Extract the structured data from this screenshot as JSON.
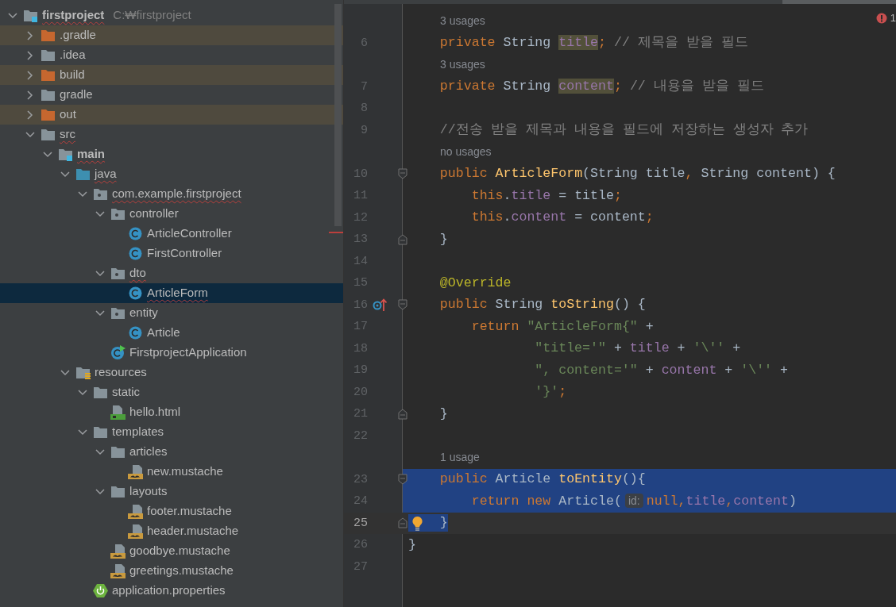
{
  "project_tree": [
    {
      "label": "firstproject",
      "path": "C:₩firstproject",
      "kind": "module",
      "expanded": true,
      "selected": false,
      "flagged": true,
      "excluded": false,
      "children": [
        {
          "label": ".gradle",
          "kind": "folder",
          "expanded": false,
          "selected": false,
          "flagged": false,
          "excluded": true
        },
        {
          "label": ".idea",
          "kind": "folder",
          "expanded": false,
          "selected": false,
          "flagged": false,
          "excluded": false
        },
        {
          "label": "build",
          "kind": "folder",
          "expanded": false,
          "selected": false,
          "flagged": false,
          "excluded": true
        },
        {
          "label": "gradle",
          "kind": "folder",
          "expanded": false,
          "selected": false,
          "flagged": false,
          "excluded": false
        },
        {
          "label": "out",
          "kind": "folder",
          "expanded": false,
          "selected": false,
          "flagged": false,
          "excluded": true
        },
        {
          "label": "src",
          "kind": "folder",
          "expanded": true,
          "selected": false,
          "flagged": true,
          "excluded": false,
          "children": [
            {
              "label": "main",
              "kind": "module",
              "expanded": true,
              "selected": false,
              "flagged": true,
              "excluded": false,
              "children": [
                {
                  "label": "java",
                  "kind": "source-folder",
                  "expanded": true,
                  "selected": false,
                  "flagged": true,
                  "excluded": false,
                  "children": [
                    {
                      "label": "com.example.firstproject",
                      "kind": "package",
                      "expanded": true,
                      "selected": false,
                      "flagged": true,
                      "excluded": false,
                      "children": [
                        {
                          "label": "controller",
                          "kind": "package",
                          "expanded": true,
                          "selected": false,
                          "flagged": false,
                          "excluded": false,
                          "children": [
                            {
                              "label": "ArticleController",
                              "kind": "class",
                              "selected": false,
                              "flagged": false,
                              "excluded": false
                            },
                            {
                              "label": "FirstController",
                              "kind": "class",
                              "selected": false,
                              "flagged": false,
                              "excluded": false
                            }
                          ]
                        },
                        {
                          "label": "dto",
                          "kind": "package",
                          "expanded": true,
                          "selected": false,
                          "flagged": true,
                          "excluded": false,
                          "children": [
                            {
                              "label": "ArticleForm",
                              "kind": "class",
                              "selected": true,
                              "flagged": true,
                              "excluded": false
                            }
                          ]
                        },
                        {
                          "label": "entity",
                          "kind": "package",
                          "expanded": true,
                          "selected": false,
                          "flagged": false,
                          "excluded": false,
                          "children": [
                            {
                              "label": "Article",
                              "kind": "class",
                              "selected": false,
                              "flagged": false,
                              "excluded": false
                            }
                          ]
                        },
                        {
                          "label": "FirstprojectApplication",
                          "kind": "app-class",
                          "selected": false,
                          "flagged": false,
                          "excluded": false
                        }
                      ]
                    }
                  ]
                },
                {
                  "label": "resources",
                  "kind": "resources-folder",
                  "expanded": true,
                  "selected": false,
                  "flagged": false,
                  "excluded": false,
                  "children": [
                    {
                      "label": "static",
                      "kind": "folder",
                      "expanded": true,
                      "selected": false,
                      "flagged": false,
                      "excluded": false,
                      "children": [
                        {
                          "label": "hello.html",
                          "kind": "html",
                          "selected": false,
                          "flagged": false,
                          "excluded": false
                        }
                      ]
                    },
                    {
                      "label": "templates",
                      "kind": "folder",
                      "expanded": true,
                      "selected": false,
                      "flagged": false,
                      "excluded": false,
                      "children": [
                        {
                          "label": "articles",
                          "kind": "folder",
                          "expanded": true,
                          "selected": false,
                          "flagged": false,
                          "excluded": false,
                          "children": [
                            {
                              "label": "new.mustache",
                              "kind": "mustache",
                              "selected": false,
                              "flagged": false,
                              "excluded": false
                            }
                          ]
                        },
                        {
                          "label": "layouts",
                          "kind": "folder",
                          "expanded": true,
                          "selected": false,
                          "flagged": false,
                          "excluded": false,
                          "children": [
                            {
                              "label": "footer.mustache",
                              "kind": "mustache",
                              "selected": false,
                              "flagged": false,
                              "excluded": false
                            },
                            {
                              "label": "header.mustache",
                              "kind": "mustache",
                              "selected": false,
                              "flagged": false,
                              "excluded": false
                            }
                          ]
                        },
                        {
                          "label": "goodbye.mustache",
                          "kind": "mustache",
                          "selected": false,
                          "flagged": false,
                          "excluded": false
                        },
                        {
                          "label": "greetings.mustache",
                          "kind": "mustache",
                          "selected": false,
                          "flagged": false,
                          "excluded": false
                        }
                      ]
                    },
                    {
                      "label": "application.properties",
                      "kind": "spring-properties",
                      "selected": false,
                      "flagged": false,
                      "excluded": false
                    }
                  ]
                }
              ]
            }
          ]
        }
      ]
    }
  ],
  "editor": {
    "error_count": "1",
    "lines": [
      {
        "kind": "hint",
        "text": "3 usages"
      },
      {
        "kind": "code",
        "number": "6",
        "selected": false,
        "current": false,
        "tokens": [
          {
            "text": "    private ",
            "kind": "keyword"
          },
          {
            "text": "String ",
            "kind": "plain"
          },
          {
            "text": "title",
            "kind": "field",
            "highlight": true
          },
          {
            "text": "; ",
            "kind": "keyword"
          },
          {
            "text": "// 제목을 받을 필드",
            "kind": "comment"
          }
        ]
      },
      {
        "kind": "hint",
        "text": "3 usages"
      },
      {
        "kind": "code",
        "number": "7",
        "selected": false,
        "current": false,
        "tokens": [
          {
            "text": "    private ",
            "kind": "keyword"
          },
          {
            "text": "String ",
            "kind": "plain"
          },
          {
            "text": "content",
            "kind": "field",
            "highlight": true
          },
          {
            "text": "; ",
            "kind": "keyword"
          },
          {
            "text": "// 내용을 받을 필드",
            "kind": "comment"
          }
        ]
      },
      {
        "kind": "code",
        "number": "8",
        "selected": false,
        "current": false
      },
      {
        "kind": "code",
        "number": "9",
        "selected": false,
        "current": false,
        "tokens": [
          {
            "text": "    //전송 받을 제목과 내용을 필드에 저장하는 생성자 추가",
            "kind": "comment"
          }
        ]
      },
      {
        "kind": "hint",
        "text": "no usages"
      },
      {
        "kind": "code",
        "number": "10",
        "selected": false,
        "current": false,
        "fold_start": true,
        "tokens": [
          {
            "text": "    public ",
            "kind": "keyword"
          },
          {
            "text": "ArticleForm",
            "kind": "method"
          },
          {
            "text": "(String title",
            "kind": "plain"
          },
          {
            "text": ", ",
            "kind": "keyword"
          },
          {
            "text": "String content) {",
            "kind": "plain"
          }
        ]
      },
      {
        "kind": "code",
        "number": "11",
        "selected": false,
        "current": false,
        "tokens": [
          {
            "text": "        this",
            "kind": "keyword"
          },
          {
            "text": ".",
            "kind": "plain"
          },
          {
            "text": "title",
            "kind": "field"
          },
          {
            "text": " = title",
            "kind": "plain"
          },
          {
            "text": ";",
            "kind": "keyword"
          }
        ]
      },
      {
        "kind": "code",
        "number": "12",
        "selected": false,
        "current": false,
        "tokens": [
          {
            "text": "        this",
            "kind": "keyword"
          },
          {
            "text": ".",
            "kind": "plain"
          },
          {
            "text": "content",
            "kind": "field"
          },
          {
            "text": " = content",
            "kind": "plain"
          },
          {
            "text": ";",
            "kind": "keyword"
          }
        ]
      },
      {
        "kind": "code",
        "number": "13",
        "selected": false,
        "current": false,
        "fold_end": true,
        "tokens": [
          {
            "text": "    }",
            "kind": "plain"
          }
        ]
      },
      {
        "kind": "code",
        "number": "14",
        "selected": false,
        "current": false
      },
      {
        "kind": "code",
        "number": "15",
        "selected": false,
        "current": false,
        "tokens": [
          {
            "text": "    @Override",
            "kind": "annotation"
          }
        ]
      },
      {
        "kind": "code",
        "number": "16",
        "selected": false,
        "current": false,
        "fold_start": true,
        "overrides": true,
        "tokens": [
          {
            "text": "    public ",
            "kind": "keyword"
          },
          {
            "text": "String ",
            "kind": "plain"
          },
          {
            "text": "toString",
            "kind": "method"
          },
          {
            "text": "() {",
            "kind": "plain"
          }
        ]
      },
      {
        "kind": "code",
        "number": "17",
        "selected": false,
        "current": false,
        "tokens": [
          {
            "text": "        return ",
            "kind": "keyword"
          },
          {
            "text": "\"ArticleForm{\"",
            "kind": "string"
          },
          {
            "text": " +",
            "kind": "plain"
          }
        ]
      },
      {
        "kind": "code",
        "number": "18",
        "selected": false,
        "current": false,
        "tokens": [
          {
            "text": "                \"title='\"",
            "kind": "string"
          },
          {
            "text": " + ",
            "kind": "plain"
          },
          {
            "text": "title",
            "kind": "field"
          },
          {
            "text": " + ",
            "kind": "plain"
          },
          {
            "text": "'\\''",
            "kind": "string"
          },
          {
            "text": " +",
            "kind": "plain"
          }
        ]
      },
      {
        "kind": "code",
        "number": "19",
        "selected": false,
        "current": false,
        "tokens": [
          {
            "text": "                \", content='\"",
            "kind": "string"
          },
          {
            "text": " + ",
            "kind": "plain"
          },
          {
            "text": "content",
            "kind": "field"
          },
          {
            "text": " + ",
            "kind": "plain"
          },
          {
            "text": "'\\''",
            "kind": "string"
          },
          {
            "text": " +",
            "kind": "plain"
          }
        ]
      },
      {
        "kind": "code",
        "number": "20",
        "selected": false,
        "current": false,
        "tokens": [
          {
            "text": "                '}'",
            "kind": "string"
          },
          {
            "text": ";",
            "kind": "keyword"
          }
        ]
      },
      {
        "kind": "code",
        "number": "21",
        "selected": false,
        "current": false,
        "fold_end": true,
        "tokens": [
          {
            "text": "    }",
            "kind": "plain"
          }
        ]
      },
      {
        "kind": "code",
        "number": "22",
        "selected": false,
        "current": false
      },
      {
        "kind": "hint",
        "text": "1 usage"
      },
      {
        "kind": "code",
        "number": "23",
        "selected": true,
        "current": false,
        "fold_start": true,
        "tokens": [
          {
            "text": "    public ",
            "kind": "keyword"
          },
          {
            "text": "Article ",
            "kind": "plain"
          },
          {
            "text": "toEntity",
            "kind": "method"
          },
          {
            "text": "(){",
            "kind": "plain"
          }
        ]
      },
      {
        "kind": "code",
        "number": "24",
        "selected": true,
        "current": false,
        "tokens": [
          {
            "text": "        return new ",
            "kind": "keyword"
          },
          {
            "text": "Article(",
            "kind": "plain"
          },
          {
            "text": "id:",
            "kind": "inlay"
          },
          {
            "text": "null,",
            "kind": "keyword"
          },
          {
            "text": "title",
            "kind": "field"
          },
          {
            "text": ",",
            "kind": "keyword"
          },
          {
            "text": "content",
            "kind": "field"
          },
          {
            "text": ")",
            "kind": "plain"
          }
        ]
      },
      {
        "kind": "code",
        "number": "25",
        "selected": true,
        "current": true,
        "fold_end": true,
        "intention": true,
        "tokens": [
          {
            "text": "    }",
            "kind": "plain"
          }
        ]
      },
      {
        "kind": "code",
        "number": "26",
        "selected": false,
        "current": false,
        "tokens": [
          {
            "text": "}",
            "kind": "plain"
          }
        ]
      },
      {
        "kind": "code",
        "number": "27",
        "selected": false,
        "current": false
      }
    ]
  }
}
